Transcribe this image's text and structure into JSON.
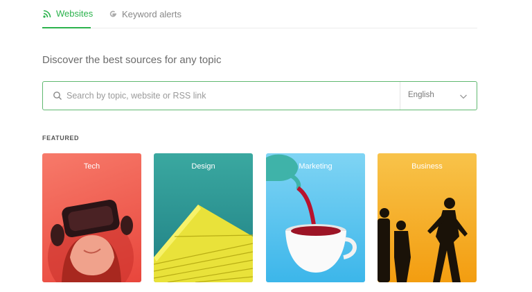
{
  "tabs": [
    {
      "label": "Websites",
      "icon": "rss-icon",
      "active": true
    },
    {
      "label": "Keyword alerts",
      "icon": "google-icon",
      "active": false
    }
  ],
  "headline": "Discover the best sources for any topic",
  "search": {
    "placeholder": "Search by topic, website or RSS link",
    "language": "English"
  },
  "featured": {
    "heading": "FEATURED",
    "cards": [
      {
        "label": "Tech"
      },
      {
        "label": "Design"
      },
      {
        "label": "Marketing"
      },
      {
        "label": "Business"
      }
    ]
  },
  "colors": {
    "accent": "#2bb24c"
  }
}
